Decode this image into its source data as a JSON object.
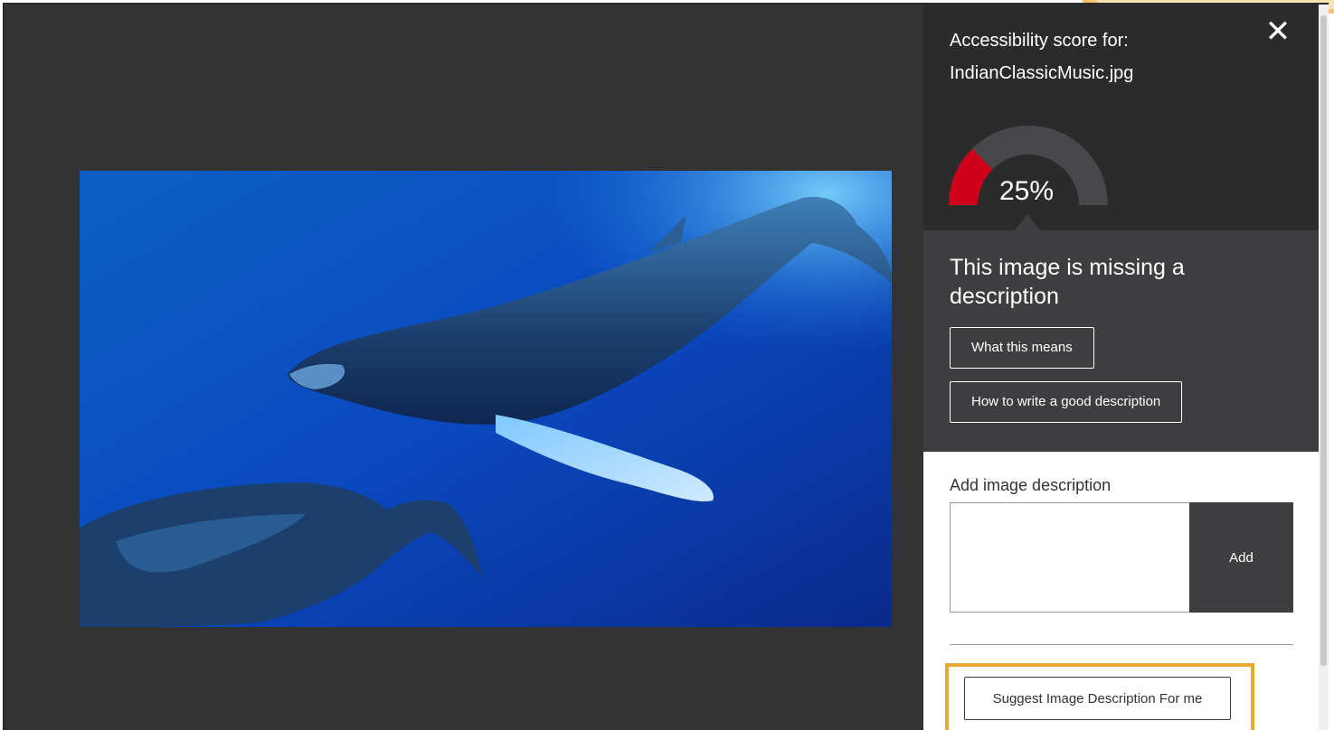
{
  "score_panel": {
    "caption_line1": "Accessibility score for:",
    "caption_line2": "IndianClassicMusic.jpg",
    "score_label": "25%",
    "score_value": 0.25,
    "close_icon": "close-icon"
  },
  "notice": {
    "title": "This image is missing a description",
    "what_this_means_label": "What this means",
    "how_to_write_label": "How to write a good description"
  },
  "description": {
    "label": "Add image description",
    "input_value": "",
    "add_label": "Add",
    "suggest_label": "Suggest Image Description For me"
  },
  "colors": {
    "modal_bg": "#333333",
    "panel_dark": "#2b2b2b",
    "notice_bg": "#3e3e41",
    "gauge_fill": "#d0001b",
    "gauge_track": "#48484c",
    "highlight": "#e8a932"
  }
}
